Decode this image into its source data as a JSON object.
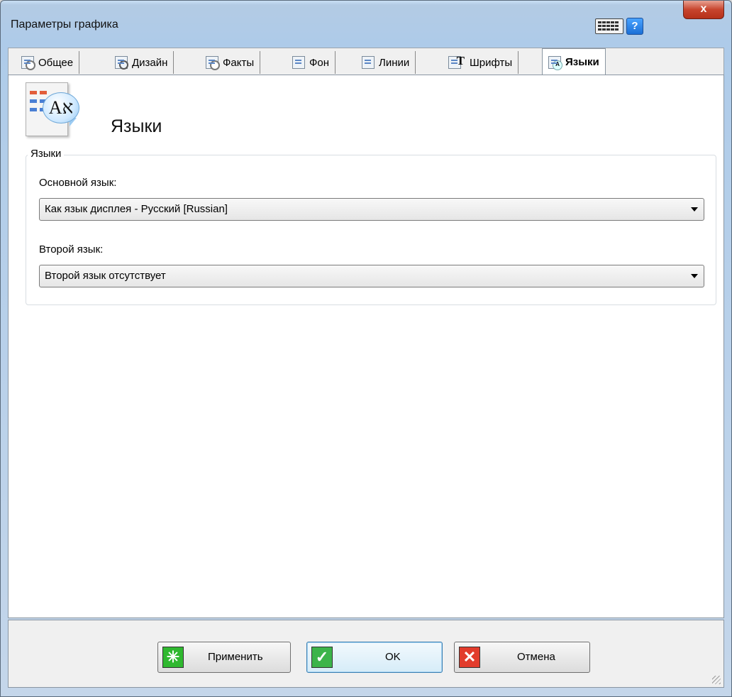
{
  "window": {
    "title": "Параметры графика",
    "help_label": "?",
    "close_label": "x"
  },
  "tabs": [
    {
      "label": "Общее",
      "icon": "gear-doc-icon"
    },
    {
      "label": "Дизайн",
      "icon": "magnifier-doc-icon"
    },
    {
      "label": "Факты",
      "icon": "clock-doc-icon"
    },
    {
      "label": "Фон",
      "icon": "background-doc-icon"
    },
    {
      "label": "Линии",
      "icon": "lines-doc-icon"
    },
    {
      "label": "Шрифты",
      "icon": "font-doc-icon"
    },
    {
      "label": "Языки",
      "icon": "language-doc-icon",
      "active": true
    }
  ],
  "header": {
    "title": "Языки",
    "icon_glyph": "Aא"
  },
  "languages_group": {
    "legend": "Языки",
    "primary_label": "Основной язык:",
    "primary_value": "Как язык дисплея - Русский [Russian]",
    "secondary_label": "Второй язык:",
    "secondary_value": "Второй язык отсутствует"
  },
  "buttons": {
    "apply": "Применить",
    "ok": "OK",
    "cancel": "Отмена"
  },
  "colors": {
    "apply_icon": "#2fb82f",
    "ok_icon": "#3cb44a",
    "cancel_icon": "#e23c2c"
  }
}
